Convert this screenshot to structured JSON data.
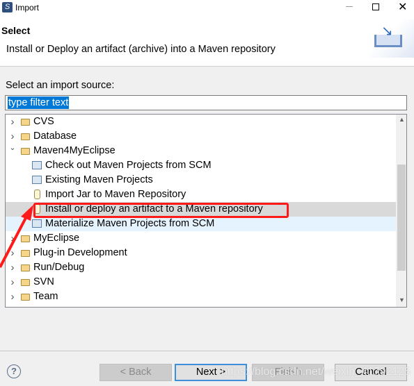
{
  "window": {
    "title": "Import"
  },
  "header": {
    "title": "Select",
    "description": "Install or Deploy an artifact (archive) into a Maven repository"
  },
  "source_label": "Select an import source:",
  "filter": {
    "value": "type filter text"
  },
  "tree": [
    {
      "label": "CVS",
      "type": "folder",
      "expanded": false,
      "level": 0
    },
    {
      "label": "Database",
      "type": "folder",
      "expanded": false,
      "level": 0
    },
    {
      "label": "Maven4MyEclipse",
      "type": "folder",
      "expanded": true,
      "level": 0
    },
    {
      "label": "Check out Maven Projects from SCM",
      "type": "maven",
      "level": 1
    },
    {
      "label": "Existing Maven Projects",
      "type": "maven",
      "level": 1
    },
    {
      "label": "Import Jar to Maven Repository",
      "type": "jar",
      "level": 1
    },
    {
      "label": "Install or deploy an artifact to a Maven repository",
      "type": "jar",
      "level": 1,
      "highlighted": true
    },
    {
      "label": "Materialize Maven Projects from SCM",
      "type": "maven",
      "level": 1,
      "hover": true
    },
    {
      "label": "MyEclipse",
      "type": "folder",
      "expanded": false,
      "level": 0
    },
    {
      "label": "Plug-in Development",
      "type": "folder",
      "expanded": false,
      "level": 0
    },
    {
      "label": "Run/Debug",
      "type": "folder",
      "expanded": false,
      "level": 0
    },
    {
      "label": "SVN",
      "type": "folder",
      "expanded": false,
      "level": 0
    },
    {
      "label": "Team",
      "type": "folder",
      "expanded": false,
      "level": 0
    }
  ],
  "buttons": {
    "back": "< Back",
    "next": "Next >",
    "finish": "Finish",
    "cancel": "Cancel"
  },
  "watermark": "https://blog.csdn.net/weixin_41792125",
  "colors": {
    "annotation": "#ff1a1a",
    "selection": "#0078d7",
    "focus": "#3c8fd8"
  }
}
